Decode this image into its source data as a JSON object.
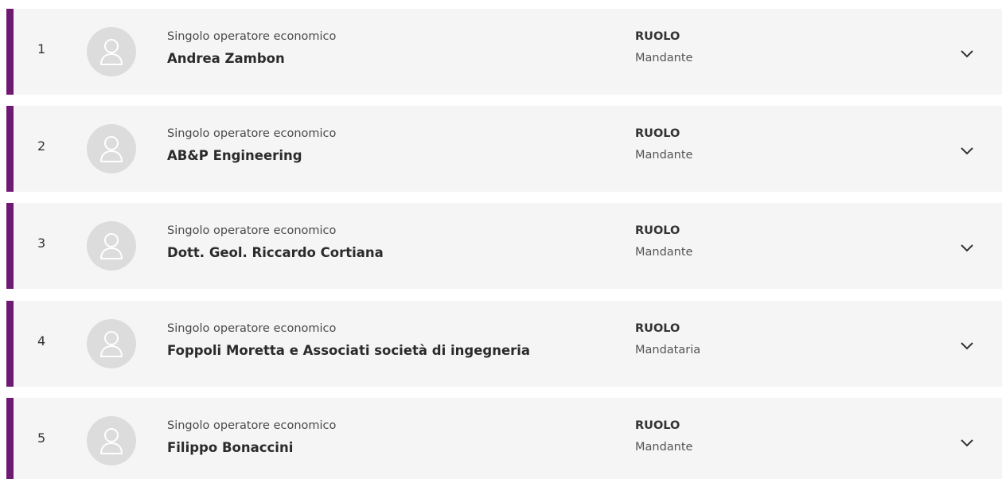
{
  "members": [
    {
      "index": "1",
      "kind": "Singolo operatore economico",
      "name": "Andrea Zambon",
      "role_label": "RUOLO",
      "role": "Mandante"
    },
    {
      "index": "2",
      "kind": "Singolo operatore economico",
      "name": "AB&P Engineering",
      "role_label": "RUOLO",
      "role": "Mandante"
    },
    {
      "index": "3",
      "kind": "Singolo operatore economico",
      "name": "Dott. Geol. Riccardo Cortiana",
      "role_label": "RUOLO",
      "role": "Mandante"
    },
    {
      "index": "4",
      "kind": "Singolo operatore economico",
      "name": "Foppoli Moretta e Associati società di ingegneria",
      "role_label": "RUOLO",
      "role": "Mandataria"
    },
    {
      "index": "5",
      "kind": "Singolo operatore economico",
      "name": "Filippo Bonaccini",
      "role_label": "RUOLO",
      "role": "Mandante"
    }
  ],
  "icons": {
    "avatar": "user-placeholder-icon",
    "expand": "chevron-down-icon"
  },
  "colors": {
    "accent": "#6f1a72",
    "row_background": "#f5f5f5",
    "avatar_background": "#dcdcdc"
  }
}
